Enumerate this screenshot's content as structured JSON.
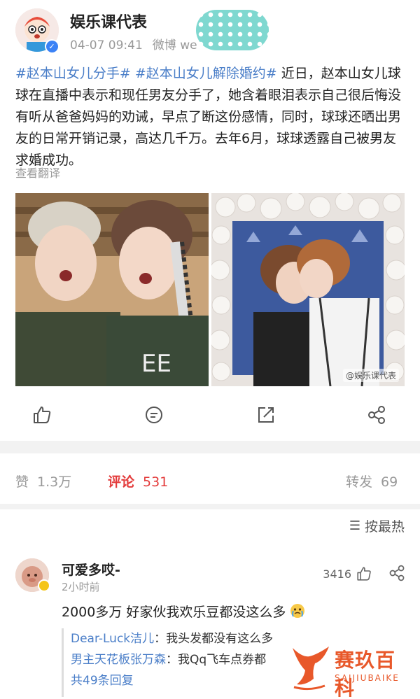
{
  "post": {
    "author": "娱乐课代表",
    "time": "04-07 09:41",
    "source": "微博 we",
    "hashtags": [
      "#赵本山女儿分手#",
      "#赵本山女儿解除婚约#"
    ],
    "text": "近日，赵本山女儿球球在直播中表示和现任男友分手了，她含着眼泪表示自己很后悔没有听从爸爸妈妈的劝诫，早点了断这份感情，同时，球球还晒出男友的日常开销记录，高达几千万。去年6月，球球透露自己被男友求婚成功。",
    "translate_label": "查看翻译",
    "image_watermark": "@娱乐课代表",
    "verified_mark": "✓"
  },
  "stats": {
    "likes_label": "赞",
    "likes_count": "1.3万",
    "comments_label": "评论",
    "comments_count": "531",
    "reposts_label": "转发",
    "reposts_count": "69"
  },
  "sort": {
    "icon": "sort-icon",
    "glyph": "☰",
    "label": "按最热"
  },
  "comment": {
    "user": "可爱多哎-",
    "time": "2小时前",
    "likes": "3416",
    "text": "2000多万  好家伙我欢乐豆都没这么多",
    "replies": [
      {
        "name": "Dear-Luck洁儿",
        "text": "：我头发都没有这么多"
      },
      {
        "name": "男主天花板张万森",
        "text": "：我Qq飞车点券都"
      }
    ],
    "more_replies": "共49条回复"
  },
  "logo": {
    "main": "赛玖百科",
    "sub": "SAIJIUBAIKE"
  },
  "icons": [
    "like-icon",
    "comment-icon",
    "share-icon",
    "more-share-icon"
  ],
  "colors": {
    "accent_red": "#e33b3b",
    "link_blue": "#4a7ec8",
    "logo_orange": "#e8582a"
  }
}
